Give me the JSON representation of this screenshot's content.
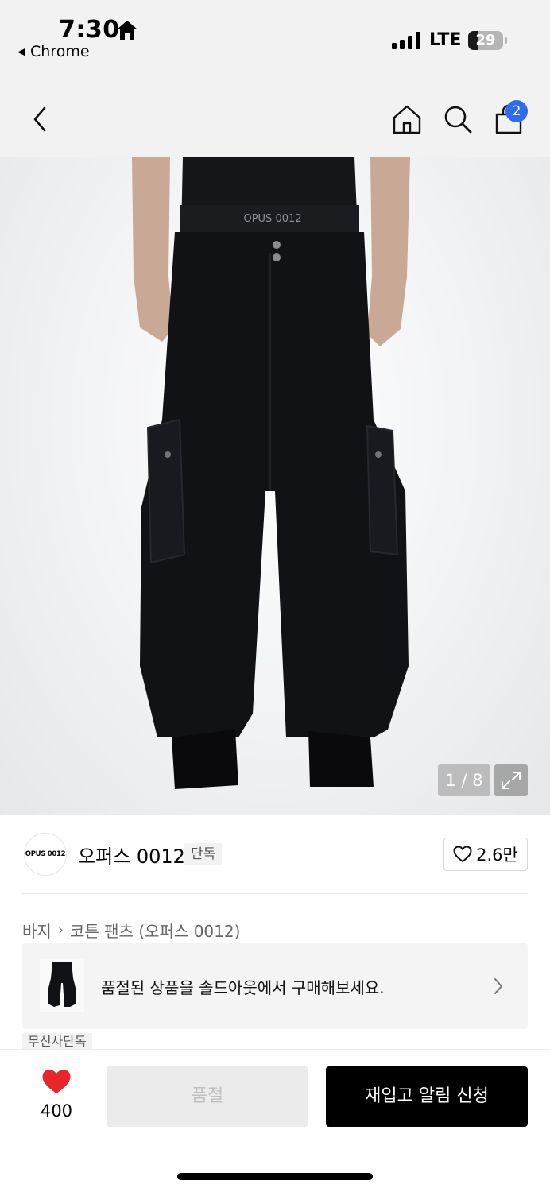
{
  "status_bar": {
    "time": "7:30",
    "back_app": "Chrome",
    "network": "LTE",
    "battery": "29",
    "battery_level": 0.29
  },
  "header": {
    "cart_count": "2"
  },
  "gallery": {
    "counter": "1 / 8",
    "waistband_text": "OPUS 0012"
  },
  "brand": {
    "logo_text": "OPUS 0012",
    "name": "오퍼스 0012",
    "exclusive_tag": "단독",
    "like_count": "2.6만"
  },
  "breadcrumb": {
    "category": "바지",
    "sub_category": "코튼 팬츠 (오퍼스 0012)"
  },
  "soldout_banner": {
    "text": "품절된 상품을 솔드아웃에서 구매해보세요."
  },
  "musinsa_tag": "무신사단독",
  "bottom_bar": {
    "wish_count": "400",
    "soldout_label": "품절",
    "restock_label": "재입고 알림 신청"
  },
  "colors": {
    "accent_blue": "#2f6bf0",
    "heart_red": "#e8262a",
    "primary_black": "#000000",
    "disabled_gray": "#ebebeb"
  }
}
